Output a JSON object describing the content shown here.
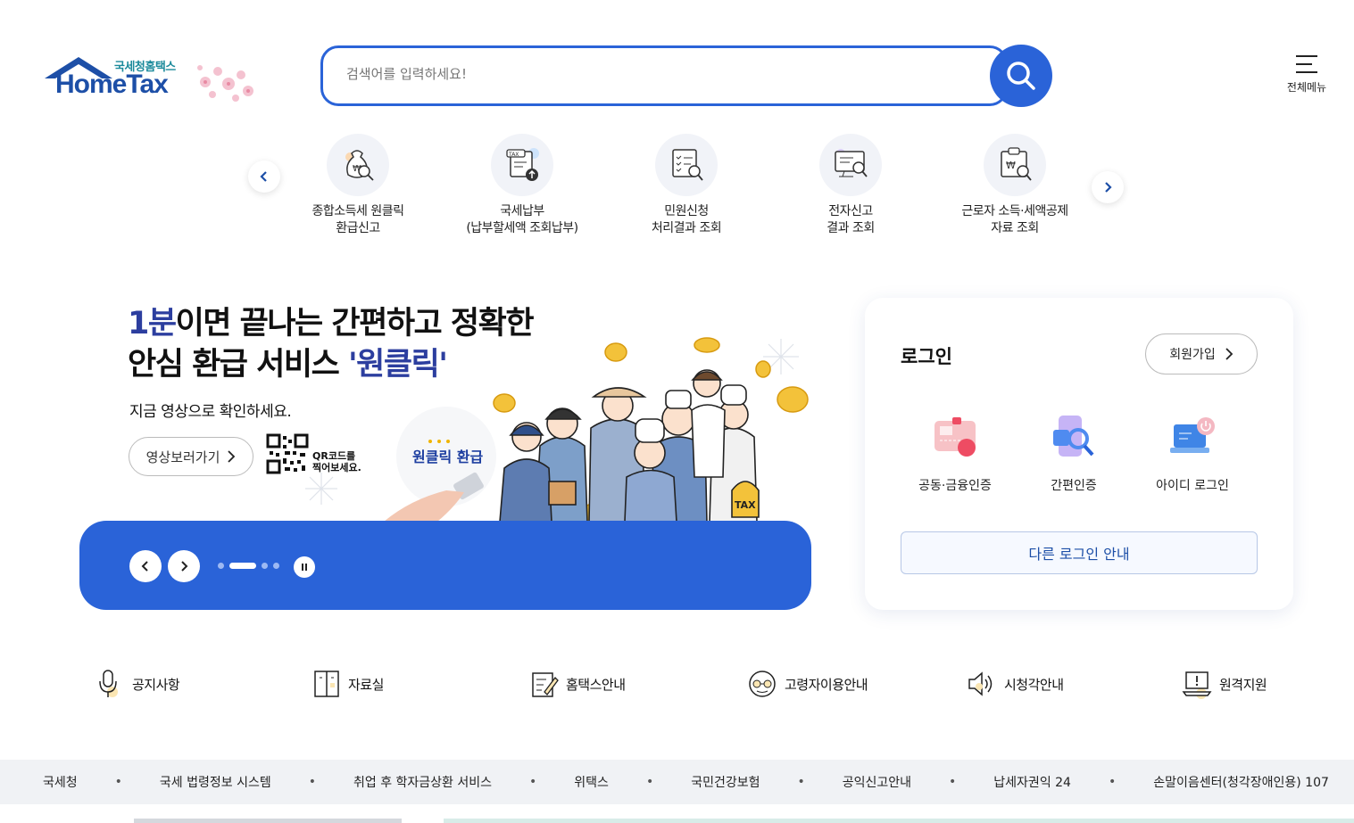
{
  "header": {
    "logo_sub": "국세청홈택스",
    "logo_main": "HomeTax",
    "search_placeholder": "검색어를 입력하세요!",
    "menu_label": "전체메뉴"
  },
  "quick_menu": [
    {
      "line1": "종합소득세 원클릭",
      "line2": "환급신고",
      "icon": "money-bag-search-icon"
    },
    {
      "line1": "국세납부",
      "line2": "(납부할세액 조회납부)",
      "icon": "tax-document-upload-icon"
    },
    {
      "line1": "민원신청",
      "line2": "처리결과 조회",
      "icon": "checklist-search-icon"
    },
    {
      "line1": "전자신고",
      "line2": "결과 조회",
      "icon": "monitor-search-icon"
    },
    {
      "line1": "근로자 소득·세액공제",
      "line2": "자료 조회",
      "icon": "clipboard-search-icon"
    }
  ],
  "banner": {
    "title_hl1": "1분",
    "title_rest1": "이면 끝나는 간편하고 정확한",
    "title_line2": "안심 환급 서비스 ",
    "title_hl2": "'원클릭'",
    "subtitle": "지금 영상으로 확인하세요.",
    "video_button": "영상보러가기",
    "qr_text1": "QR코드를",
    "qr_text2": "찍어보세요.",
    "illus_label": "원클릭 환급",
    "illus_tax": "TAX",
    "active_slide": 2,
    "total_slides": 4
  },
  "login": {
    "title": "로그인",
    "join": "회원가입",
    "options": [
      {
        "label": "공동·금융인증",
        "icon": "certificate-card-icon"
      },
      {
        "label": "간편인증",
        "icon": "phone-search-icon"
      },
      {
        "label": "아이디 로그인",
        "icon": "laptop-power-icon"
      }
    ],
    "other": "다른 로그인 안내"
  },
  "shortcuts": [
    {
      "label": "공지사항",
      "icon": "microphone-icon"
    },
    {
      "label": "자료실",
      "icon": "cabinet-icon"
    },
    {
      "label": "홈택스안내",
      "icon": "document-edit-icon"
    },
    {
      "label": "고령자이용안내",
      "icon": "glasses-face-icon"
    },
    {
      "label": "시청각안내",
      "icon": "speaker-icon"
    },
    {
      "label": "원격지원",
      "icon": "laptop-alert-icon"
    }
  ],
  "footer_links": [
    "국세청",
    "국세 법령정보 시스템",
    "취업 후 학자금상환 서비스",
    "위택스",
    "국민건강보험",
    "공익신고안내",
    "납세자권익 24",
    "손말이음센터(청각장애인용) 107"
  ],
  "colors": {
    "primary": "#2a63d8",
    "brand": "#1d4fa7",
    "accent_text": "#2c3e9f"
  }
}
